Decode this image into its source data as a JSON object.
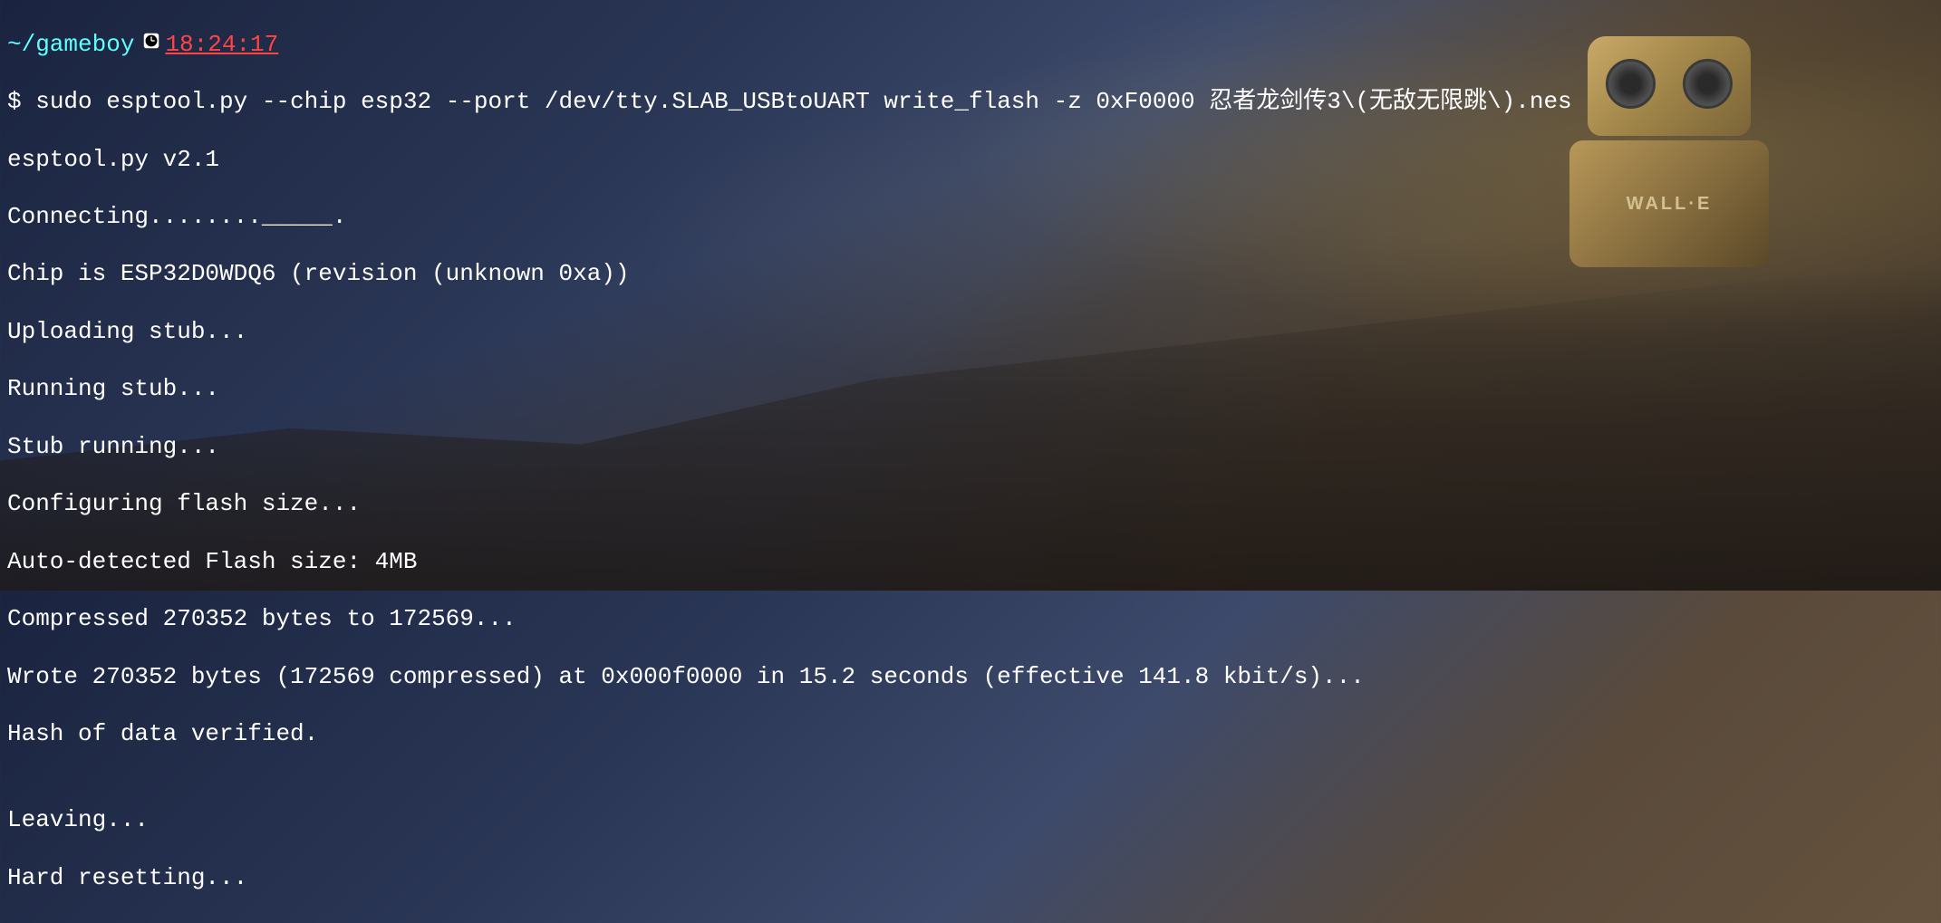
{
  "prompt": {
    "path": "~/gameboy",
    "time": "18:24:17",
    "symbol": "$ ",
    "command": "sudo esptool.py --chip esp32 --port /dev/tty.SLAB_USBtoUART write_flash -z 0xF0000 忍者龙剑传3\\(无敌无限跳\\).nes"
  },
  "output": {
    "l1": "esptool.py v2.1",
    "l2": "Connecting........_____.",
    "l3": "Chip is ESP32D0WDQ6 (revision (unknown 0xa))",
    "l4": "Uploading stub...",
    "l5": "Running stub...",
    "l6": "Stub running...",
    "l7": "Configuring flash size...",
    "l8": "Auto-detected Flash size: 4MB",
    "l9": "Compressed 270352 bytes to 172569...",
    "l10": "Wrote 270352 bytes (172569 compressed) at 0x000f0000 in 15.2 seconds (effective 141.8 kbit/s)...",
    "l11": "Hash of data verified.",
    "l12": "",
    "l13": "Leaving...",
    "l14": "Hard resetting..."
  },
  "background": {
    "robot_label": "WALL·E"
  }
}
